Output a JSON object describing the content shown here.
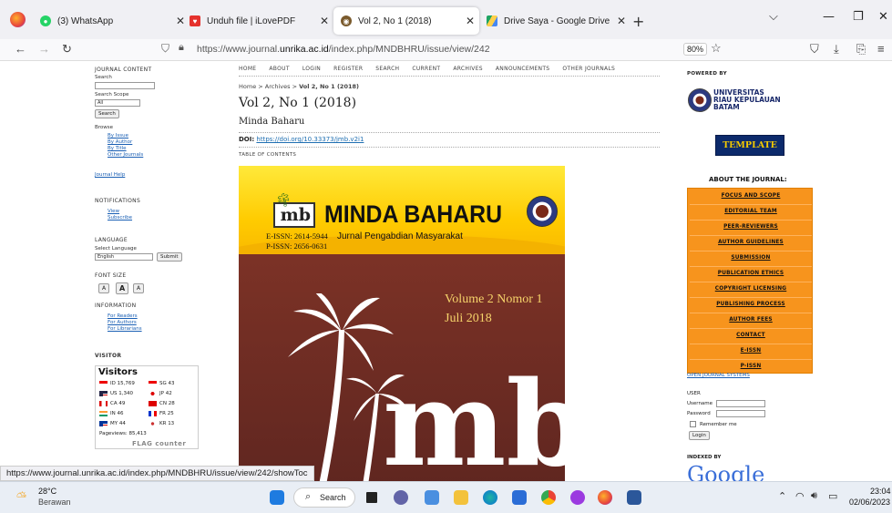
{
  "browser": {
    "tabs": [
      {
        "title": "(3) WhatsApp",
        "icon": "whatsapp-icon",
        "color": "#25d366"
      },
      {
        "title": "Unduh file | iLovePDF",
        "icon": "ilovepdf-icon",
        "color": "#e5322d"
      },
      {
        "title": "Vol 2, No 1 (2018)",
        "icon": "journal-icon",
        "color": "#7a5a2c"
      },
      {
        "title": "Drive Saya - Google Drive",
        "icon": "google-drive-icon",
        "color": "#1fa463"
      }
    ],
    "url_prefix": "https://www.journal.",
    "url_domain": "unrika.ac.id",
    "url_suffix": "/index.php/MNDBHRU/issue/view/242",
    "zoom": "80%",
    "status_url": "https://www.journal.unrika.ac.id/index.php/MNDBHRU/issue/view/242/showToc"
  },
  "left": {
    "journal_content": "JOURNAL CONTENT",
    "search": "Search",
    "search_scope": "Search Scope",
    "scope_value": "All",
    "search_btn": "Search",
    "browse": "Browse",
    "browse_items": [
      "By Issue",
      "By Author",
      "By Title",
      "Other Journals"
    ],
    "journal_help": "Journal Help",
    "notifications": "NOTIFICATIONS",
    "notif_items": [
      "View",
      "Subscribe"
    ],
    "language": "LANGUAGE",
    "select_language": "Select Language",
    "language_value": "English",
    "submit": "Submit",
    "font_size": "FONT SIZE",
    "font_btns": [
      "A",
      "A",
      "A"
    ],
    "information": "INFORMATION",
    "info_items": [
      "For Readers",
      "For Authors",
      "For Librarians"
    ],
    "visitor": "VISITOR"
  },
  "visitors": {
    "title": "Visitors",
    "rows": [
      {
        "code": "ID",
        "count": "15,769",
        "code2": "SG",
        "count2": "43"
      },
      {
        "code": "US",
        "count": "1,340",
        "code2": "JP",
        "count2": "42"
      },
      {
        "code": "CA",
        "count": "49",
        "code2": "CN",
        "count2": "28"
      },
      {
        "code": "IN",
        "count": "46",
        "code2": "FR",
        "count2": "25"
      },
      {
        "code": "MY",
        "count": "44",
        "code2": "KR",
        "count2": "13"
      }
    ],
    "pageviews": "Pageviews: 85,413",
    "flag_counter": "FLAG counter"
  },
  "topnav": [
    "HOME",
    "ABOUT",
    "LOGIN",
    "REGISTER",
    "SEARCH",
    "CURRENT",
    "ARCHIVES",
    "ANNOUNCEMENTS",
    "OTHER JOURNALS"
  ],
  "main": {
    "breadcrumb_home": "Home",
    "breadcrumb_archives": "Archives",
    "breadcrumb_current": "Vol 2, No 1 (2018)",
    "title": "Vol 2, No 1 (2018)",
    "subtitle": "Minda Baharu",
    "doi_label": "DOI:",
    "doi_link": "https://doi.org/10.33373/jmb.v2i1",
    "toc": "TABLE OF CONTENTS"
  },
  "cover": {
    "logo_text": "mb",
    "journal_name": "MINDA BAHARU",
    "eissn": "E-ISSN: 2614-5944",
    "pissn": "P-ISSN: 2656-0631",
    "tagline": "Jurnal Pengabdian Masyarakat",
    "volume": "Volume 2 Nomor 1",
    "date": "Juli 2018",
    "big_logo": "mb"
  },
  "right": {
    "powered_by": "POWERED BY",
    "univ_line1": "UNIVERSITAS",
    "univ_line2": "RIAU KEPULAUAN",
    "univ_line3": "BATAM",
    "template": "TEMPLATE",
    "about": "ABOUT THE JOURNAL:",
    "menu": [
      "FOCUS AND SCOPE",
      "EDITORIAL TEAM",
      "PEER-REVIEWERS",
      "AUTHOR GUIDELINES",
      "SUBMISSION",
      "PUBLICATION ETHICS",
      "COPYRIGHT LICENSING",
      "PUBLISHING PROCESS",
      "AUTHOR FEES",
      "CONTACT",
      "E-ISSN",
      "P-ISSN"
    ],
    "ojs": "OPEN JOURNAL SYSTEMS",
    "user": "USER",
    "username": "Username",
    "password": "Password",
    "remember": "Remember me",
    "login": "Login",
    "indexed": "INDEXED BY",
    "google": "Google"
  },
  "taskbar": {
    "temp": "28°C",
    "weather": "Berawan",
    "search": "Search",
    "time": "23:04",
    "date": "02/06/2023"
  }
}
